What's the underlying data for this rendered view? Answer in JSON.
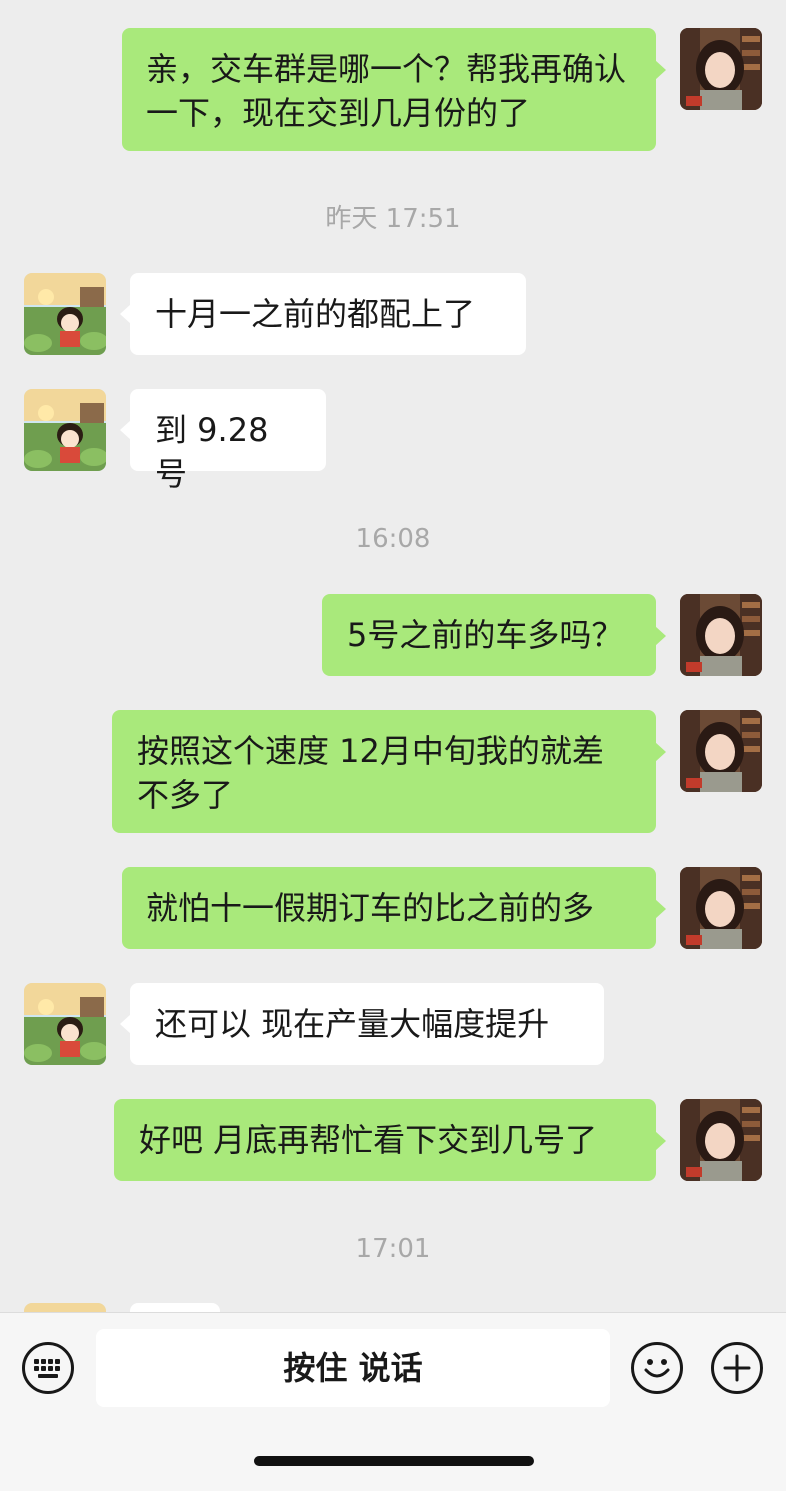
{
  "messages": [
    {
      "type": "sent",
      "avatar": "avatar-girl",
      "text": "亲，交车群是哪一个？帮我再确认一下，现在交到几月份的了"
    },
    {
      "type": "timestamp",
      "text": "昨天 17:51"
    },
    {
      "type": "received",
      "avatar": "avatar-cartoon",
      "text": "十月一之前的都配上了"
    },
    {
      "type": "received",
      "avatar": "avatar-cartoon",
      "text": "到 9.28 号"
    },
    {
      "type": "timestamp",
      "text": "16:08"
    },
    {
      "type": "sent",
      "avatar": "avatar-girl",
      "text": "5号之前的车多吗？"
    },
    {
      "type": "sent",
      "avatar": "avatar-girl",
      "text": "按照这个速度 12月中旬我的就差不多了"
    },
    {
      "type": "sent",
      "avatar": "avatar-girl",
      "text": "就怕十一假期订车的比之前的多"
    },
    {
      "type": "received",
      "avatar": "avatar-cartoon",
      "text": "还可以 现在产量大幅度提升"
    },
    {
      "type": "sent",
      "avatar": "avatar-girl",
      "text": "好吧 月底再帮忙看下交到几号了"
    },
    {
      "type": "timestamp",
      "text": "17:01"
    }
  ],
  "input_bar": {
    "voice_label": "按住 说话",
    "keyboard_icon": "keyboard-icon",
    "emoji_icon": "emoji-icon",
    "plus_icon": "plus-icon"
  },
  "colors": {
    "background": "#ededed",
    "sent_bubble": "#a9e97b",
    "received_bubble": "#ffffff",
    "timestamp_text": "#a8a8a8"
  }
}
